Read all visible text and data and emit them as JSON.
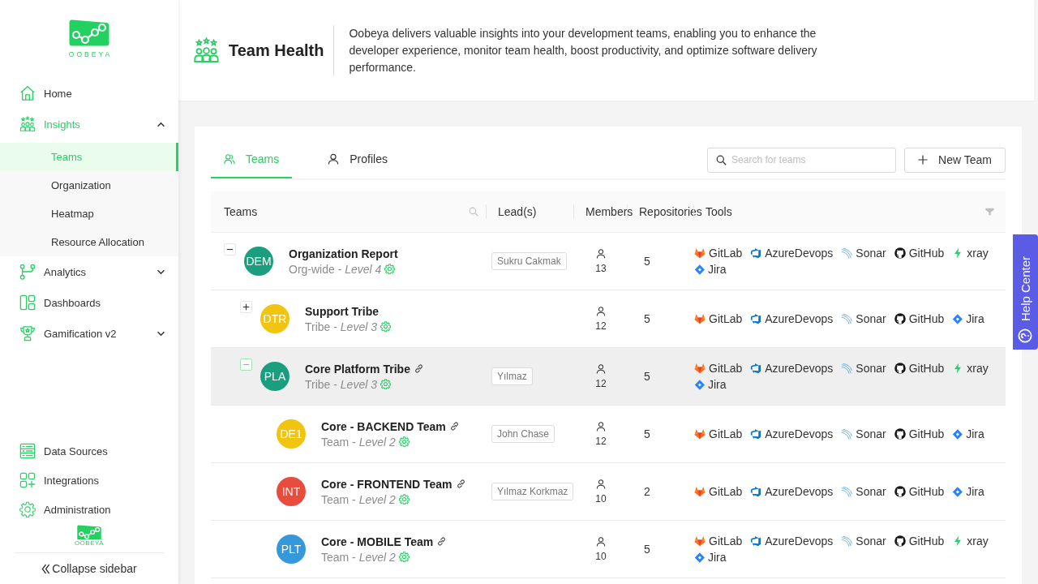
{
  "sidebar": {
    "logo": {
      "text": "OOBEYA"
    },
    "items": [
      {
        "label": "Home",
        "kind": "link",
        "selected": false
      },
      {
        "label": "Insights",
        "kind": "group",
        "selected": true,
        "expanded": true,
        "children": [
          {
            "label": "Teams",
            "selected": true
          },
          {
            "label": "Organization",
            "selected": false
          },
          {
            "label": "Heatmap",
            "selected": false
          },
          {
            "label": "Resource Allocation",
            "selected": false
          }
        ]
      },
      {
        "label": "Analytics",
        "kind": "group",
        "selected": false,
        "expanded": false
      },
      {
        "label": "Dashboards",
        "kind": "link",
        "selected": false
      },
      {
        "label": "Gamification v2",
        "kind": "group",
        "selected": false,
        "expanded": false
      }
    ],
    "bottom_items": [
      {
        "label": "Data Sources",
        "selected": false
      },
      {
        "label": "Integrations",
        "selected": false
      },
      {
        "label": "Administration",
        "selected": false
      }
    ],
    "footer_logo": {
      "text": "OOBEYA"
    },
    "collapse": {
      "label": "Collapse sidebar"
    }
  },
  "header": {
    "title": "Team Health",
    "description": "Oobeya delivers valuable insights into your development teams, enabling you to enhance the developer experience, monitor team health, boost productivity, and optimize software delivery performance."
  },
  "tabs": [
    {
      "label": "Teams",
      "selected": true
    },
    {
      "label": "Profiles",
      "selected": false
    }
  ],
  "search": {
    "placeholder": "Search for teams"
  },
  "new_button": {
    "label": "New Team"
  },
  "table": {
    "columns": [
      "Teams",
      "Lead(s)",
      "Members",
      "Repositories",
      "Tools"
    ],
    "rows": [
      {
        "name": "Organization Report",
        "initials": "DEM",
        "color": "#1a9e7e",
        "subtitle": "Org-wide - *Level 4*",
        "kind": "group",
        "expanded": true,
        "linked": false,
        "highlighted": false,
        "leads": [
          "Sukru Cakmak"
        ],
        "members": "13",
        "repositories": "5",
        "tools": [
          {
            "kind": "gitlab",
            "name": "GitLab"
          },
          {
            "kind": "azure",
            "name": "AzureDevops"
          },
          {
            "kind": "sonar",
            "name": "Sonar"
          },
          {
            "kind": "github",
            "name": "GitHub"
          },
          {
            "kind": "xray",
            "name": "xray"
          },
          {
            "kind": "jira",
            "name": "Jira"
          }
        ],
        "children": [
          {
            "name": "Support Tribe",
            "initials": "DTR",
            "color": "#f1c40f",
            "subtitle": "Tribe - *Level 3*",
            "kind": "group",
            "expanded": false,
            "linked": false,
            "highlighted": false,
            "members": "12",
            "repositories": "5",
            "tools": [
              {
                "kind": "gitlab",
                "name": "GitLab"
              },
              {
                "kind": "azure",
                "name": "AzureDevops"
              },
              {
                "kind": "sonar",
                "name": "Sonar"
              },
              {
                "kind": "github",
                "name": "GitHub"
              },
              {
                "kind": "jira",
                "name": "Jira"
              }
            ]
          },
          {
            "name": "Core Platform Tribe",
            "initials": "PLA",
            "color": "#1a9e7e",
            "subtitle": "Tribe - *Level 3*",
            "kind": "group",
            "expanded": true,
            "linked": true,
            "highlighted": true,
            "leads": [
              "Yılmaz"
            ],
            "members": "12",
            "repositories": "5",
            "tools": [
              {
                "kind": "gitlab",
                "name": "GitLab"
              },
              {
                "kind": "azure",
                "name": "AzureDevops"
              },
              {
                "kind": "sonar",
                "name": "Sonar"
              },
              {
                "kind": "github",
                "name": "GitHub"
              },
              {
                "kind": "xray",
                "name": "xray"
              },
              {
                "kind": "jira",
                "name": "Jira"
              }
            ],
            "children": [
              {
                "name": "Core - BACKEND Team",
                "initials": "DE1",
                "color": "#f1c40f",
                "subtitle": "Team - *Level 2*",
                "kind": "leaf",
                "linked": true,
                "highlighted": false,
                "leads": [
                  "John Chase"
                ],
                "members": "12",
                "repositories": "5",
                "tools": [
                  {
                    "kind": "gitlab",
                    "name": "GitLab"
                  },
                  {
                    "kind": "azure",
                    "name": "AzureDevops"
                  },
                  {
                    "kind": "sonar",
                    "name": "Sonar"
                  },
                  {
                    "kind": "github",
                    "name": "GitHub"
                  },
                  {
                    "kind": "jira",
                    "name": "Jira"
                  }
                ]
              },
              {
                "name": "Core - FRONTEND Team",
                "initials": "INT",
                "color": "#e74c3c",
                "subtitle": "Team - *Level 2*",
                "kind": "leaf",
                "linked": true,
                "highlighted": false,
                "leads": [
                  "Yılmaz Korkmaz"
                ],
                "members": "10",
                "repositories": "2",
                "tools": [
                  {
                    "kind": "gitlab",
                    "name": "GitLab"
                  },
                  {
                    "kind": "azure",
                    "name": "AzureDevops"
                  },
                  {
                    "kind": "sonar",
                    "name": "Sonar"
                  },
                  {
                    "kind": "github",
                    "name": "GitHub"
                  },
                  {
                    "kind": "jira",
                    "name": "Jira"
                  }
                ]
              },
              {
                "name": "Core - MOBILE Team",
                "initials": "PLT",
                "color": "#3498db",
                "subtitle": "Team - *Level 2*",
                "kind": "leaf",
                "linked": true,
                "highlighted": false,
                "members": "10",
                "repositories": "5",
                "tools": [
                  {
                    "kind": "gitlab",
                    "name": "GitLab"
                  },
                  {
                    "kind": "azure",
                    "name": "AzureDevops"
                  },
                  {
                    "kind": "sonar",
                    "name": "Sonar"
                  },
                  {
                    "kind": "github",
                    "name": "GitHub"
                  },
                  {
                    "kind": "xray",
                    "name": "xray"
                  },
                  {
                    "kind": "jira",
                    "name": "Jira"
                  }
                ]
              }
            ]
          }
        ]
      }
    ]
  },
  "help_center": {
    "label": "Help Center"
  }
}
